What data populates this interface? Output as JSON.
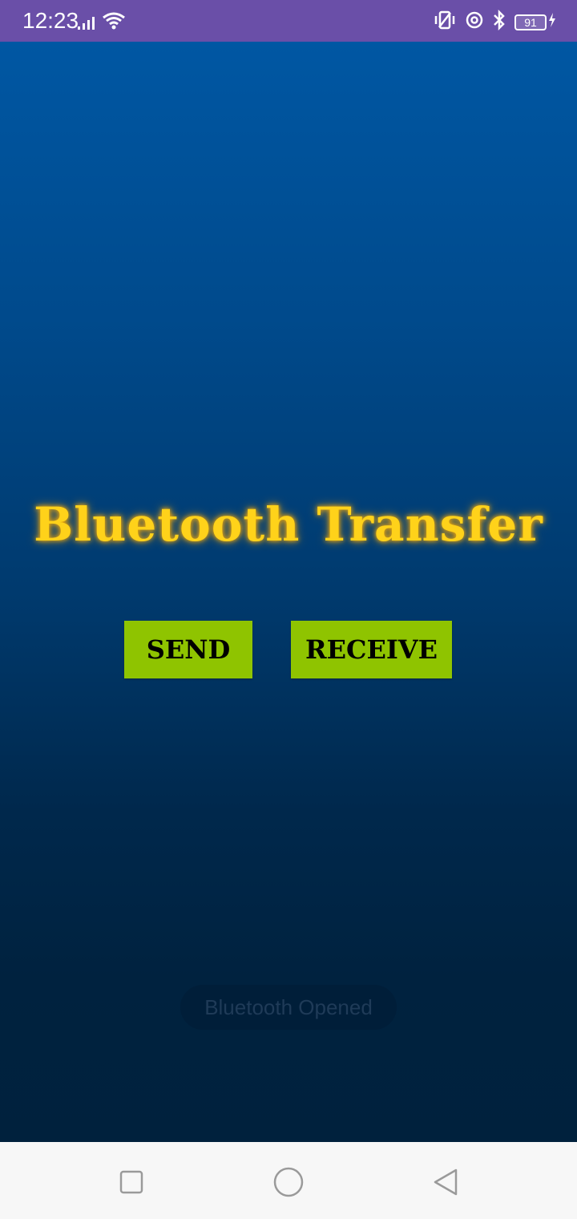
{
  "status_bar": {
    "time": "12:23",
    "battery_level": "91",
    "background_color": "#6a4fa8",
    "left_icons": [
      "signal-icon",
      "wifi-icon"
    ],
    "right_icons": [
      "vibrate-icon",
      "at-icon",
      "bluetooth-icon",
      "battery-icon",
      "charging-icon"
    ]
  },
  "app": {
    "title": "Bluetooth Transfer",
    "title_color": "#ffd21a",
    "send_label": "SEND",
    "receive_label": "RECEIVE",
    "button_color": "#8fc400",
    "toast": "Bluetooth Opened"
  },
  "nav_bar": {
    "buttons": [
      "recent-apps-icon",
      "home-icon",
      "back-icon"
    ]
  }
}
